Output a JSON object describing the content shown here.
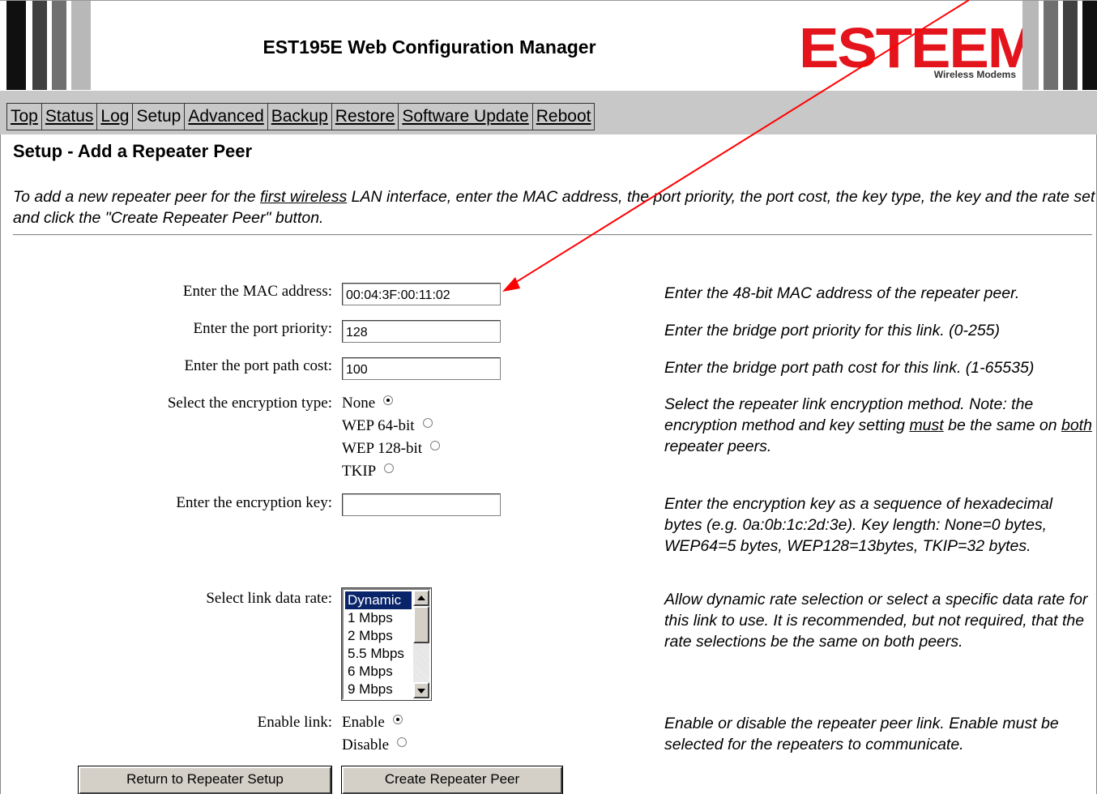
{
  "header": {
    "title": "EST195E Web Configuration Manager",
    "logo_text": "ESTEEM",
    "logo_subtitle": "Wireless Modems"
  },
  "nav": {
    "tabs": [
      {
        "label": "Top"
      },
      {
        "label": "Status"
      },
      {
        "label": "Log"
      },
      {
        "label": "Setup"
      },
      {
        "label": "Advanced"
      },
      {
        "label": "Backup"
      },
      {
        "label": "Restore"
      },
      {
        "label": "Software Update"
      },
      {
        "label": "Reboot"
      }
    ],
    "active": "Setup"
  },
  "page": {
    "title": "Setup - Add a Repeater Peer",
    "intro_part1": "To add a new repeater peer for the ",
    "intro_link": "first wireless",
    "intro_part2": " LAN interface, enter the MAC address, the port priority, the port cost, the key type, the key and the rate set and click the \"Create Repeater Peer\" button."
  },
  "form": {
    "mac": {
      "label": "Enter the MAC address:",
      "value": "00:04:3F:00:11:02",
      "help": "Enter the 48-bit MAC address of the repeater peer."
    },
    "priority": {
      "label": "Enter the port priority:",
      "value": "128",
      "help": "Enter the bridge port priority for this link. (0-255)"
    },
    "cost": {
      "label": "Enter the port path cost:",
      "value": "100",
      "help": "Enter the bridge port path cost for this link. (1-65535)"
    },
    "encryption": {
      "label": "Select the encryption type:",
      "options": [
        "None",
        "WEP 64-bit",
        "WEP 128-bit",
        "TKIP"
      ],
      "selected": "None",
      "help_part1": "Select the repeater link encryption method. Note: the encryption method and key setting ",
      "help_must": "must",
      "help_part2": " be the same on ",
      "help_both": "both",
      "help_part3": " repeater peers."
    },
    "key": {
      "label": "Enter the encryption key:",
      "value": "",
      "help": "Enter the encryption key as a sequence of hexadecimal bytes (e.g. 0a:0b:1c:2d:3e). Key length: None=0 bytes, WEP64=5 bytes, WEP128=13bytes, TKIP=32 bytes."
    },
    "rate": {
      "label": "Select link data rate:",
      "options": [
        "Dynamic",
        "1 Mbps",
        "2 Mbps",
        "5.5 Mbps",
        "6 Mbps",
        "9 Mbps"
      ],
      "selected": "Dynamic",
      "help": "Allow dynamic rate selection or select a specific data rate for this link to use. It is recommended, but not required, that the rate selections be the same on both peers."
    },
    "enable": {
      "label": "Enable link:",
      "options": [
        "Enable",
        "Disable"
      ],
      "selected": "Enable",
      "help": "Enable or disable the repeater peer link. Enable must be selected for the repeaters to communicate."
    }
  },
  "buttons": {
    "return_label": "Return to Repeater Setup",
    "create_label": "Create Repeater Peer"
  },
  "colors": {
    "logo_red": "#e3141c",
    "nav_bg": "#c8c8c8",
    "annotation_arrow": "#ff0000",
    "list_selection": "#0a246a"
  }
}
